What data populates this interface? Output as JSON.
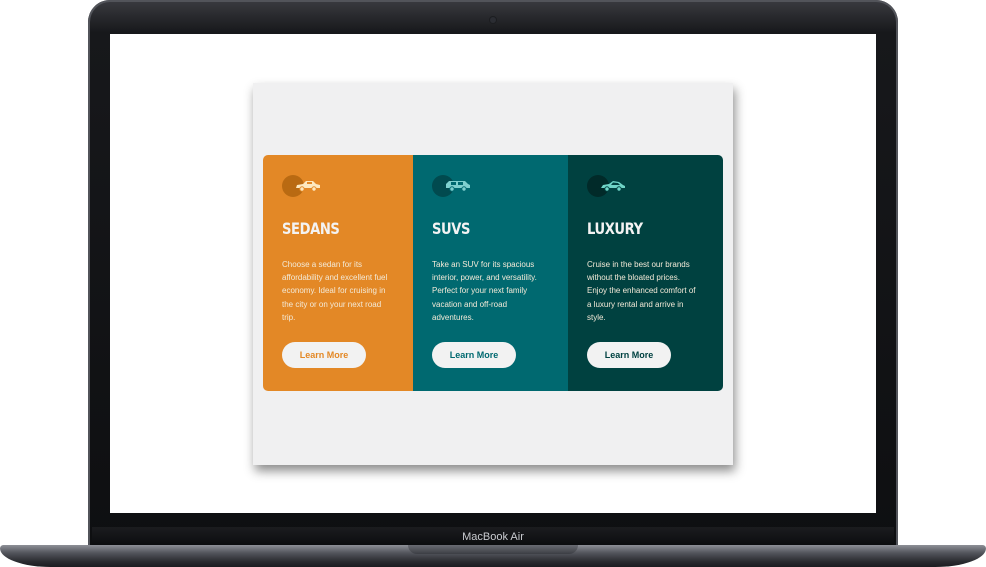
{
  "device": {
    "label": "MacBook Air"
  },
  "colors": {
    "sedans": "#e38826",
    "suvs": "#006970",
    "luxury": "#004140",
    "page_bg": "#f0f0f1",
    "button_bg": "#f2f2f2"
  },
  "cards": [
    {
      "title": "SEDANS",
      "icon": "sedan-car-icon",
      "description": "Choose a sedan for its affordability and excellent fuel economy. Ideal for cruising in the city or on your next road trip.",
      "button_label": "Learn More"
    },
    {
      "title": "SUVS",
      "icon": "suv-car-icon",
      "description": "Take an SUV for its spacious interior, power, and versatility. Perfect for your next family vacation and off-road adventures.",
      "button_label": "Learn More"
    },
    {
      "title": "LUXURY",
      "icon": "luxury-car-icon",
      "description": "Cruise in the best our brands without the bloated prices. Enjoy the enhanced comfort of a luxury rental and arrive in style.",
      "button_label": "Learn More"
    }
  ]
}
